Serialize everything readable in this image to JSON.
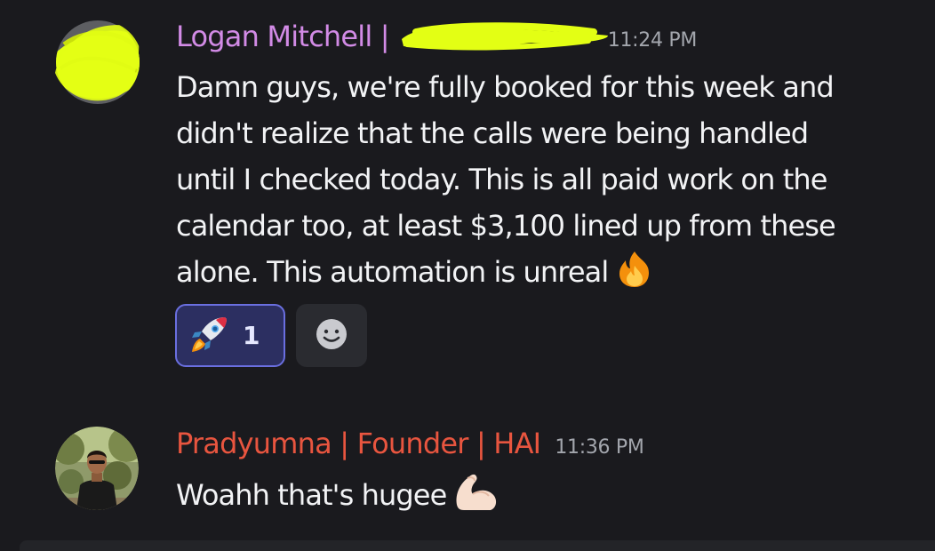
{
  "messages": [
    {
      "author": "Logan Mitchell |",
      "author_color": "#d28be6",
      "timestamp": "11:24 PM",
      "lines": [
        "Damn guys, we're fully booked for this week and",
        "didn't realize that the calls were being handled",
        "until I checked today. This is all paid work on the",
        "calendar too, at least $3,100 lined up from these",
        "alone. This automation is unreal"
      ],
      "trailing_emoji": "fire-emoji",
      "reactions": [
        {
          "emoji": "rocket-emoji",
          "count": "1",
          "active": true
        }
      ],
      "redaction_color": "#e3ff14"
    },
    {
      "author": "Pradyumna | Founder | HAI",
      "author_color": "#e8553f",
      "timestamp": "11:36 PM",
      "lines": [
        "Woahh that's hugee"
      ],
      "trailing_emoji": "flexed-biceps-emoji"
    }
  ]
}
